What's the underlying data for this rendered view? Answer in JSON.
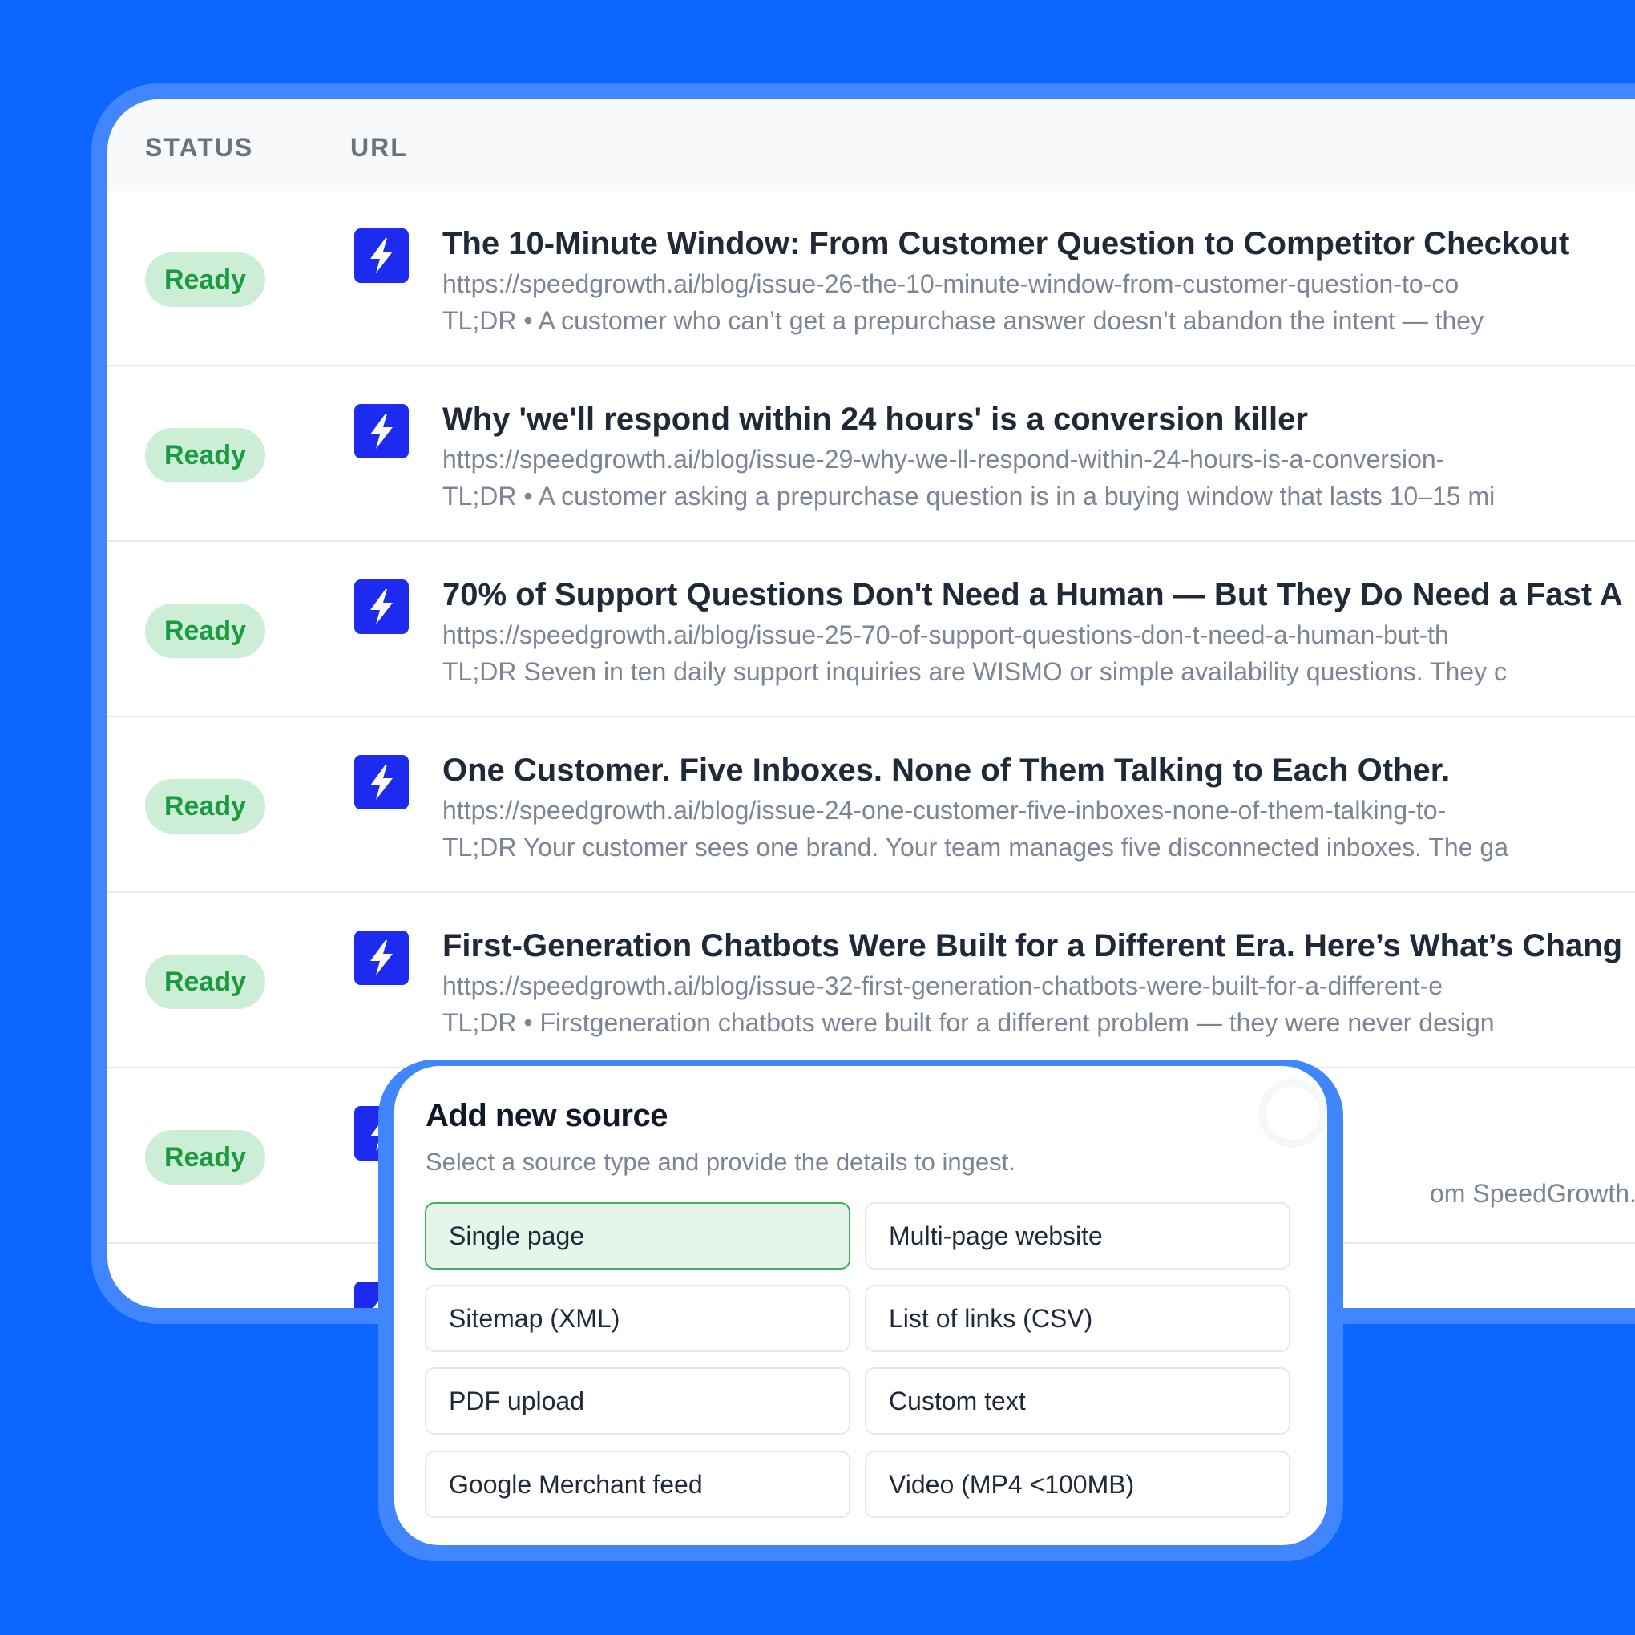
{
  "table": {
    "columns": {
      "status": "STATUS",
      "url": "URL"
    },
    "rows": [
      {
        "status": "Ready",
        "title": "The 10-Minute Window: From Customer Question to Competitor Checkout",
        "url": "https://speedgrowth.ai/blog/issue-26-the-10-minute-window-from-customer-question-to-co",
        "tldr": "TL;DR • A customer who can’t get a prepurchase answer doesn’t abandon the intent — they"
      },
      {
        "status": "Ready",
        "title": "Why 'we'll respond within 24 hours' is a conversion killer",
        "url": "https://speedgrowth.ai/blog/issue-29-why-we-ll-respond-within-24-hours-is-a-conversion-",
        "tldr": "TL;DR • A customer asking a prepurchase question is in a buying window that lasts 10–15 mi"
      },
      {
        "status": "Ready",
        "title": "70% of Support Questions Don't Need a Human — But They Do Need a Fast A",
        "url": "https://speedgrowth.ai/blog/issue-25-70-of-support-questions-don-t-need-a-human-but-th",
        "tldr": "TL;DR Seven in ten daily support inquiries are WISMO or simple availability questions. They c"
      },
      {
        "status": "Ready",
        "title": "One Customer. Five Inboxes. None of Them Talking to Each Other.",
        "url": "https://speedgrowth.ai/blog/issue-24-one-customer-five-inboxes-none-of-them-talking-to-",
        "tldr": "TL;DR Your customer sees one brand. Your team manages five disconnected inboxes. The ga"
      },
      {
        "status": "Ready",
        "title": "First-Generation Chatbots Were Built for a Different Era. Here’s What’s Chang",
        "url": "https://speedgrowth.ai/blog/issue-32-first-generation-chatbots-were-built-for-a-different-e",
        "tldr": "TL;DR • Firstgeneration chatbots were built for a different problem — they were never design"
      },
      {
        "status": "Ready",
        "title": "",
        "url": "",
        "tldr": "om SpeedGrowth."
      }
    ]
  },
  "modal": {
    "title": "Add new source",
    "subtitle": "Select a source type and provide the details to ingest.",
    "selected": "Single page",
    "options": [
      "Single page",
      "Multi-page website",
      "Sitemap (XML)",
      "List of links (CSV)",
      "PDF upload",
      "Custom text",
      "Google Merchant feed",
      "Video (MP4 <100MB)"
    ]
  },
  "colors": {
    "background": "#0d66ff",
    "ready_badge_bg": "#cdeed6",
    "ready_badge_text": "#1b9a3f",
    "logo": "#1d2bf0",
    "selected_option_bg": "#e5f5e9",
    "selected_option_border": "#36b45b"
  },
  "icons": {
    "row_logo": "lightning-bolt-icon"
  }
}
